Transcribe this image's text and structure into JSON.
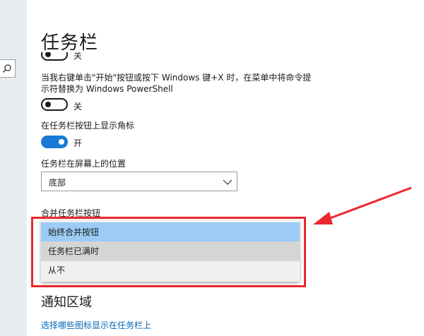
{
  "page": {
    "title": "任务栏"
  },
  "top_toggle": {
    "state_label": "关"
  },
  "powershell": {
    "description_line1": "当我右键单击\"开始\"按钮或按下 Windows 键+X 时，在菜单中将命令提",
    "description_line2": "示符替换为 Windows PowerShell",
    "toggle_label": "关",
    "toggle_on": false
  },
  "badges": {
    "description": "在任务栏按钮上显示角标",
    "toggle_label": "开",
    "toggle_on": true
  },
  "position": {
    "label": "任务栏在屏幕上的位置",
    "selected": "底部"
  },
  "combine": {
    "label": "合并任务栏按钮",
    "options": [
      "始终合并按钮",
      "任务栏已满时",
      "从不"
    ],
    "selected_index": 0
  },
  "notification": {
    "title": "通知区域",
    "link": "选择哪些图标显示在任务栏上"
  },
  "colors": {
    "accent": "#1979d6",
    "highlight": "#e8282e",
    "link": "#0066b4",
    "selected_option": "#9ccbf5"
  },
  "icons": [
    "search-icon",
    "chevron-down-icon",
    "arrow-annotation"
  ]
}
